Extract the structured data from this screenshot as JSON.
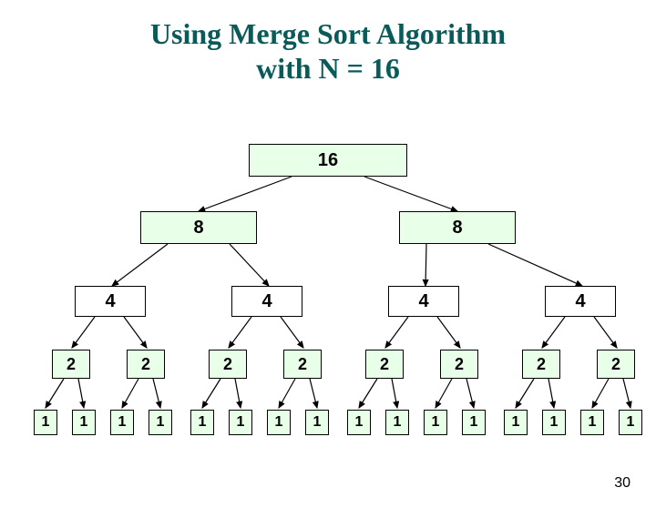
{
  "title_line1": "Using Merge Sort Algorithm",
  "title_line2": "with N = 16",
  "slide_number": "30",
  "tree": {
    "root": "16",
    "level8": [
      "8",
      "8"
    ],
    "level4": [
      "4",
      "4",
      "4",
      "4"
    ],
    "level2": [
      "2",
      "2",
      "2",
      "2",
      "2",
      "2",
      "2",
      "2"
    ],
    "level1": [
      "1",
      "1",
      "1",
      "1",
      "1",
      "1",
      "1",
      "1",
      "1",
      "1",
      "1",
      "1",
      "1",
      "1",
      "1",
      "1"
    ]
  }
}
